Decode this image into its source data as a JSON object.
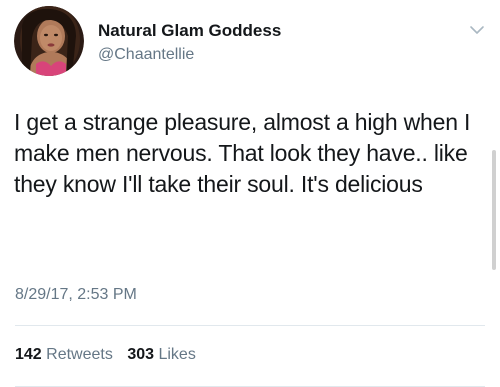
{
  "user": {
    "display_name": "Natural Glam Goddess",
    "handle": "@Chaantellie",
    "avatar_icon": "profile-photo"
  },
  "tweet": {
    "text": "I get a strange pleasure, almost a high when I make men nervous. That look they have.. like they know I'll take their soul. It's delicious",
    "timestamp": "8/29/17, 2:53 PM"
  },
  "stats": {
    "retweets_count": "142",
    "retweets_label": "Retweets",
    "likes_count": "303",
    "likes_label": "Likes"
  },
  "icons": {
    "menu": "chevron-down-icon"
  },
  "colors": {
    "text": "#14171a",
    "secondary_text": "#657786",
    "divider": "#e1e8ed"
  }
}
